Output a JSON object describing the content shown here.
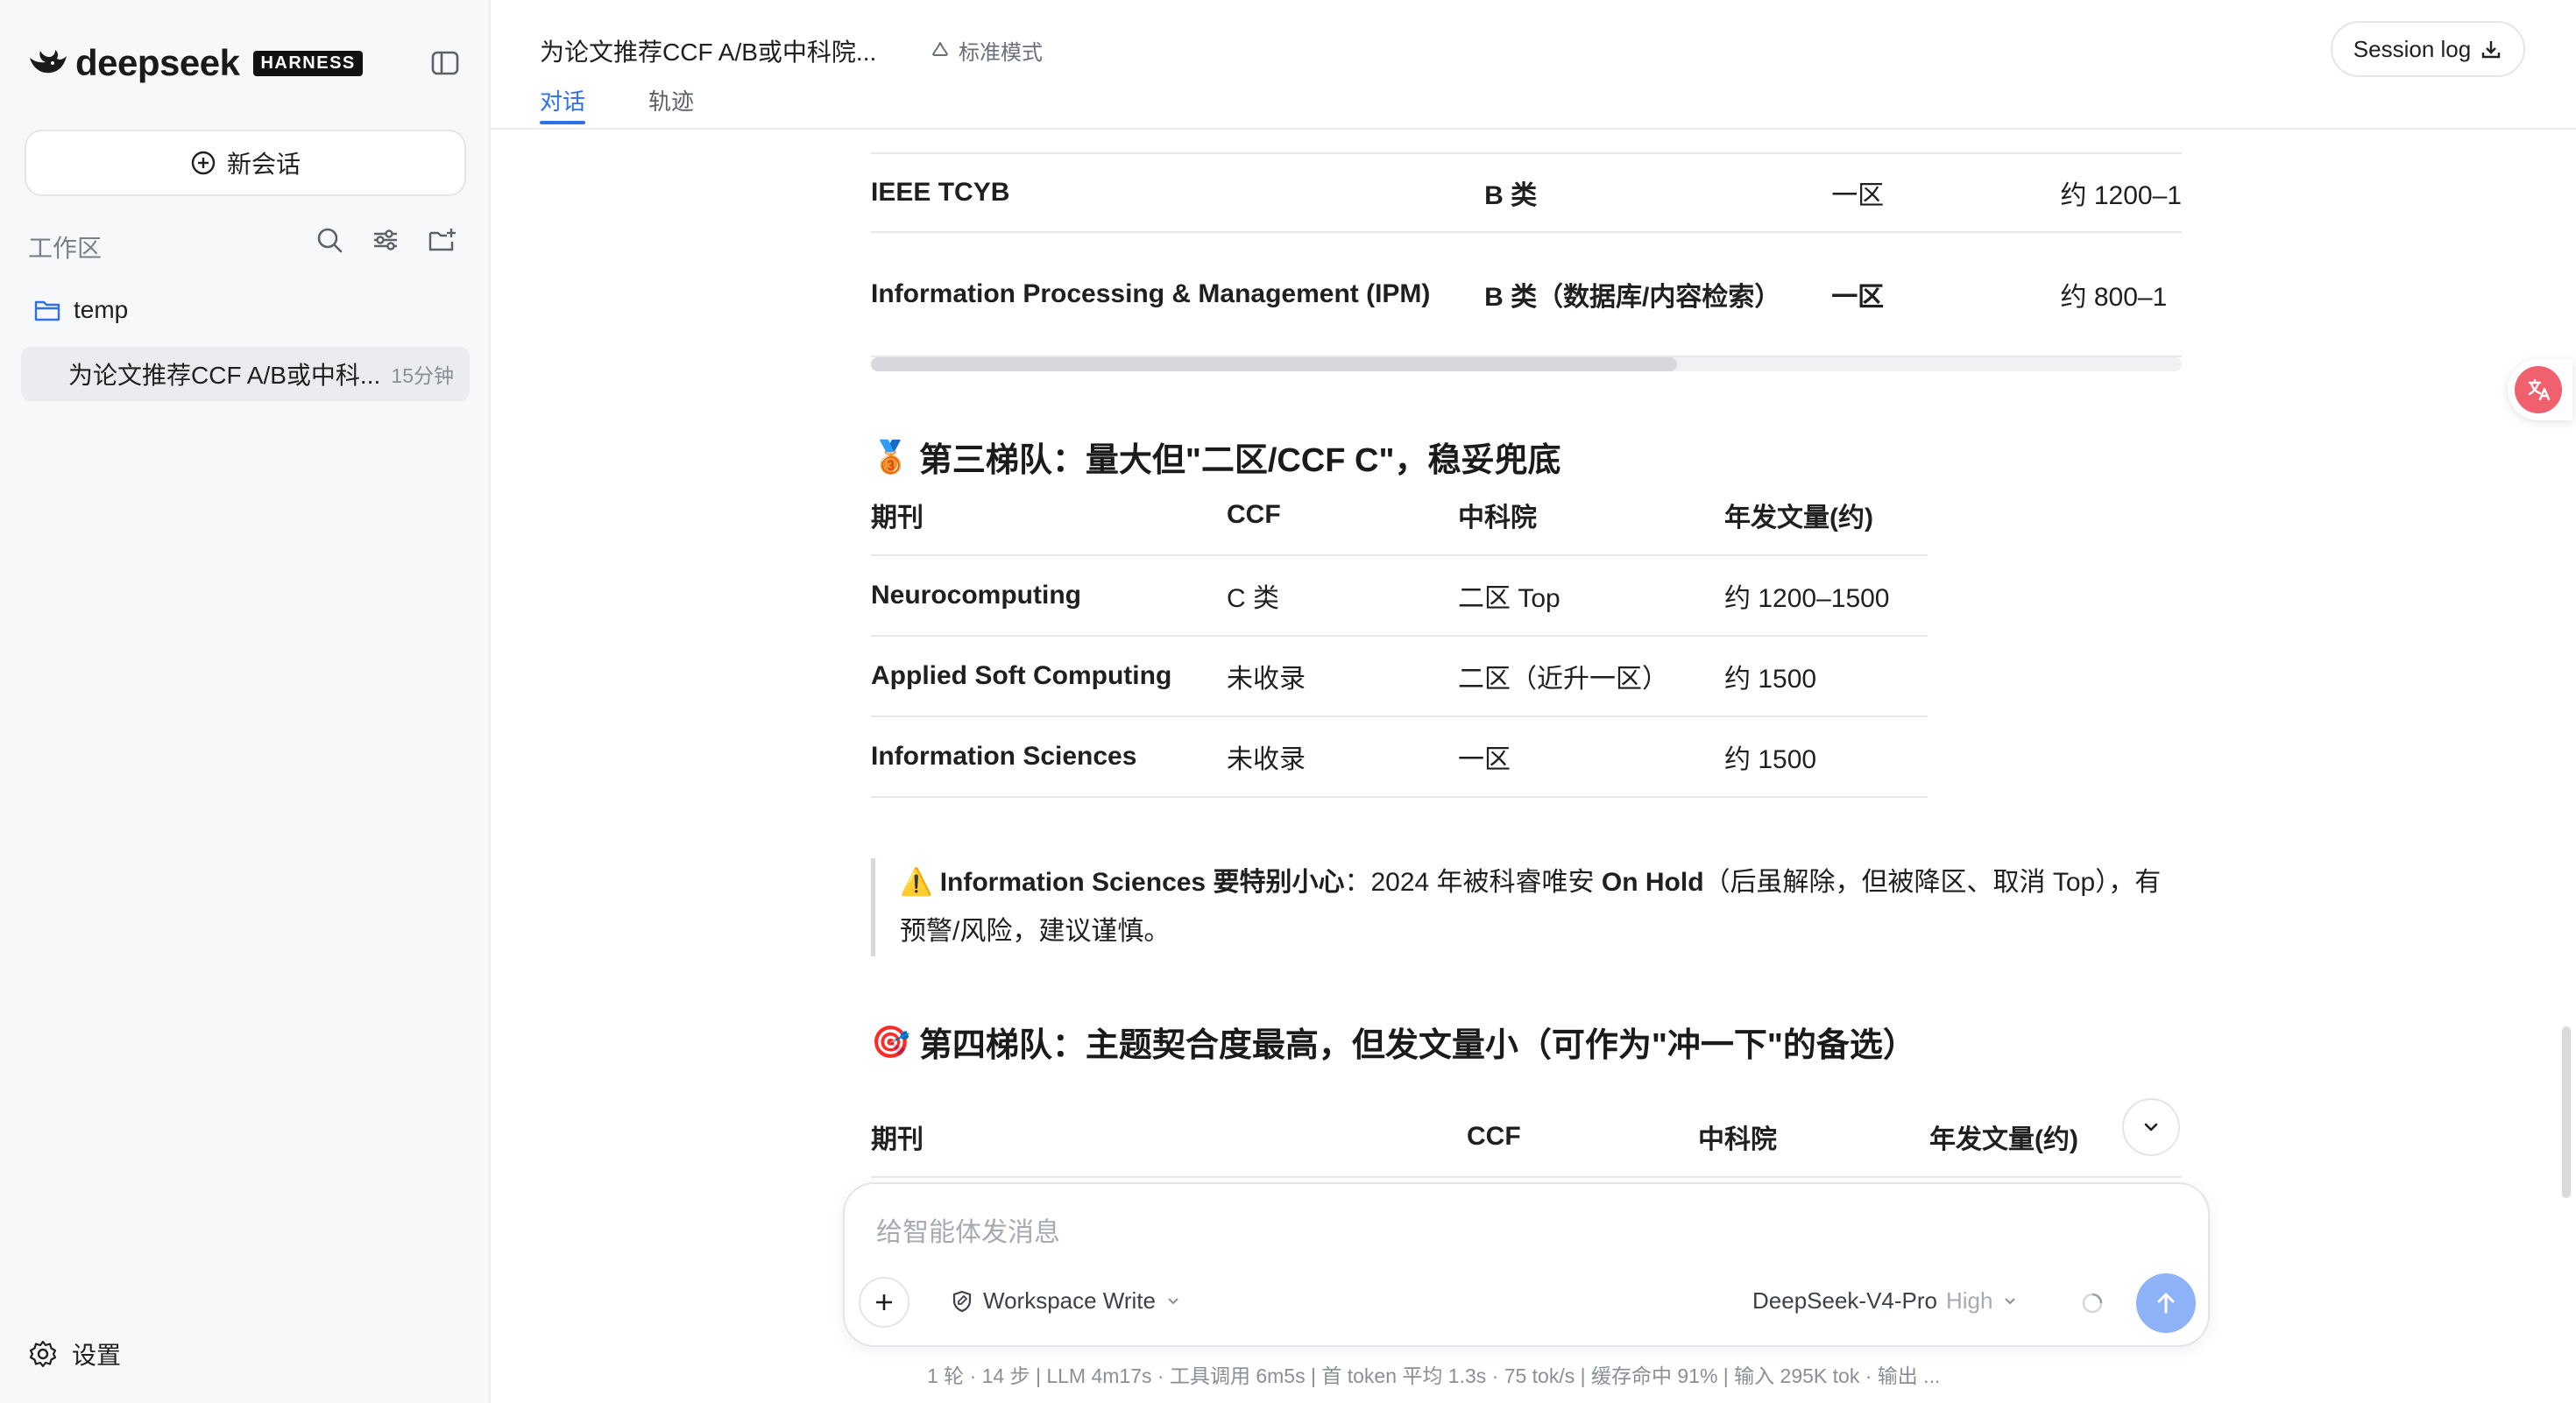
{
  "sidebar": {
    "brand": "deepseek",
    "badge": "HARNESS",
    "new_chat": "新会话",
    "workspace_label": "工作区",
    "folder": "temp",
    "session": {
      "title": "为论文推荐CCF A/B或中科...",
      "time": "15分钟"
    },
    "settings": "设置"
  },
  "header": {
    "title": "为论文推荐CCF A/B或中科院...",
    "mode": "标准模式",
    "tabs": [
      {
        "label": "对话",
        "active": true
      },
      {
        "label": "轨迹",
        "active": false
      }
    ],
    "session_log": "Session log"
  },
  "table1": {
    "rows": [
      {
        "name": "IEEE TCYB",
        "ccf": "B 类",
        "cas": "一区",
        "volume": "约 1200–1"
      },
      {
        "name": "Information Processing & Management (IPM)",
        "ccf": "B 类（数据库/内容检索）",
        "cas": "一区",
        "volume": "约 800–1"
      }
    ]
  },
  "section3": {
    "emoji": "🥉",
    "title": "第三梯队：量大但\"二区/CCF C\"，稳妥兜底",
    "headers": [
      "期刊",
      "CCF",
      "中科院",
      "年发文量(约)"
    ],
    "rows": [
      {
        "name": "Neurocomputing",
        "ccf": "C 类",
        "cas": "二区 Top",
        "volume": "约 1200–1500"
      },
      {
        "name": "Applied Soft Computing",
        "ccf": "未收录",
        "cas": "二区（近升一区）",
        "volume": "约 1500"
      },
      {
        "name": "Information Sciences",
        "ccf": "未收录",
        "cas": "一区",
        "volume": "约 1500"
      }
    ]
  },
  "callout": {
    "icon": "⚠️",
    "bold1": "Information Sciences 要特别小心",
    "text1": "：2024 年被科睿唯安 ",
    "bold2": "On Hold",
    "text2": "（后虽解除，但被降区、取消 Top），有预警/风险，建议谨慎。"
  },
  "section4": {
    "emoji": "🎯",
    "title": "第四梯队：主题契合度最高，但发文量小（可作为\"冲一下\"的备选）",
    "headers": [
      "期刊",
      "CCF",
      "中科院",
      "年发文量(约)"
    ]
  },
  "composer": {
    "placeholder": "给智能体发消息",
    "permission": "Workspace Write",
    "model": "DeepSeek-V4-Pro",
    "level": "High"
  },
  "status_bar": "1 轮 · 14 步   |   LLM 4m17s · 工具调用 6m5s   |   首 token 平均 1.3s · 75 tok/s   |   缓存命中 91%   |   输入 295K tok · 输出 ...",
  "colors": {
    "accent": "#2f6fea",
    "send": "#8fb3f8",
    "translate": "#f0606d"
  }
}
